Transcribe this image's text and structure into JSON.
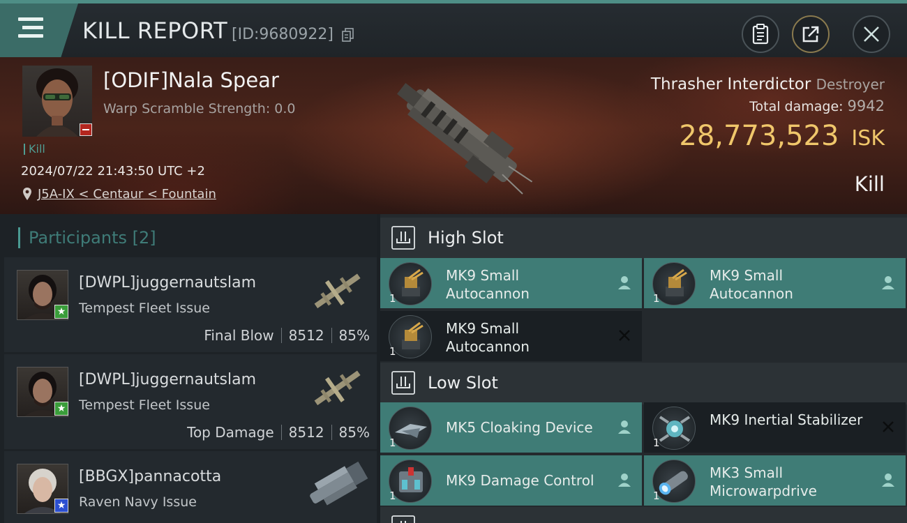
{
  "header": {
    "title": "KILL REPORT",
    "report_id": "[ID:9680922]"
  },
  "victim": {
    "name": "[ODIF]Nala Spear",
    "warp_scramble": "Warp Scramble Strength: 0.0",
    "tag": "Kill",
    "datetime": "2024/07/22 21:43:50 UTC +2",
    "location": "J5A-IX < Centaur < Fountain",
    "ship_name": "Thrasher Interdictor",
    "ship_class": "Destroyer",
    "total_damage_label": "Total damage:",
    "total_damage": "9942",
    "isk_value": "28,773,523",
    "isk_unit": "ISK",
    "result": "Kill"
  },
  "participants": {
    "title": "Participants [2]",
    "items": [
      {
        "name": "[DWPL]juggernautslam",
        "ship": "Tempest Fleet Issue",
        "role": "Final Blow",
        "damage": "8512",
        "percent": "85%"
      },
      {
        "name": "[DWPL]juggernautslam",
        "ship": "Tempest Fleet Issue",
        "role": "Top Damage",
        "damage": "8512",
        "percent": "85%"
      },
      {
        "name": "[BBGX]pannacotta",
        "ship": "Raven Navy Issue",
        "role": "",
        "damage": "",
        "percent": ""
      }
    ]
  },
  "slots": {
    "high": {
      "title": "High Slot",
      "modules": [
        {
          "name": "MK9 Small Autocannon",
          "qty": "1",
          "status": "fitted"
        },
        {
          "name": "MK9 Small Autocannon",
          "qty": "1",
          "status": "fitted"
        },
        {
          "name": "MK9 Small Autocannon",
          "qty": "1",
          "status": "destroyed"
        }
      ]
    },
    "low": {
      "title": "Low Slot",
      "modules": [
        {
          "name": "MK5 Cloaking Device",
          "qty": "1",
          "status": "fitted"
        },
        {
          "name": "MK9 Inertial Stabilizer",
          "qty": "1",
          "status": "destroyed"
        },
        {
          "name": "MK9 Damage Control",
          "qty": "1",
          "status": "fitted"
        },
        {
          "name": "MK3 Small Microwarpdrive",
          "qty": "1",
          "status": "fitted"
        }
      ]
    }
  },
  "colors": {
    "accent_teal": "#3f7c76",
    "isk_gold": "#f0c76b",
    "header_accent": "#4e8e86"
  }
}
